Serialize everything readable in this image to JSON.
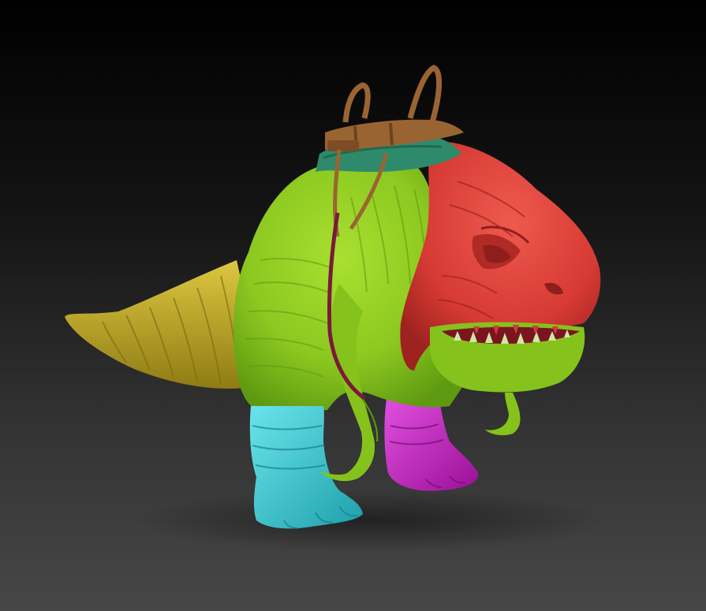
{
  "scene": {
    "subject": "creature-sculpt",
    "background": {
      "top": "#000000",
      "bottom": "#474747"
    },
    "polygroup_colors": {
      "head": "#d63a33",
      "mouth_inner": "#7a1520",
      "body": "#8cc820",
      "body_shade": "#5e9a10",
      "tail": "#c8b02a",
      "tail_shade": "#8f7c14",
      "front_leg": "#2ec8d2",
      "back_leg": "#c020c0",
      "harness": "#9a6432",
      "harness_dark": "#6e4220",
      "collar": "#2e8a6a",
      "strap": "#7a1a3a",
      "teeth": "#cfe8a0"
    }
  }
}
